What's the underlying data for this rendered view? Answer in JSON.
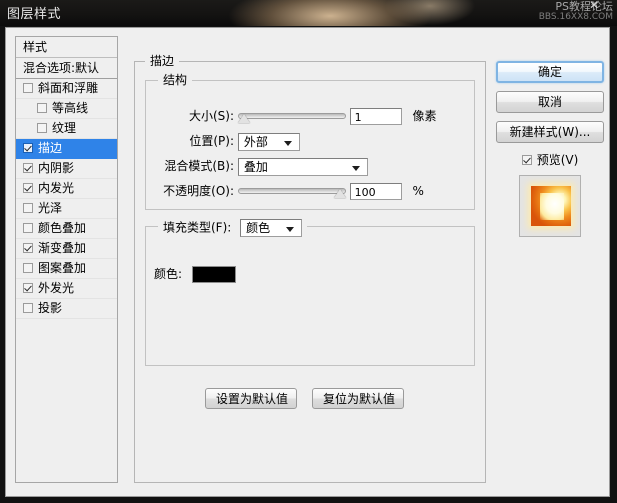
{
  "window": {
    "title": "图层样式",
    "watermark_line1": "PS教程论坛",
    "watermark_line2": "BBS.16XX8.COM",
    "close_glyph": "✕"
  },
  "styles_panel": {
    "header": "样式",
    "blending_options": "混合选项:默认",
    "effects": [
      {
        "label": "斜面和浮雕",
        "checked": false,
        "selected": false,
        "indent": false
      },
      {
        "label": "等高线",
        "checked": false,
        "selected": false,
        "indent": true
      },
      {
        "label": "纹理",
        "checked": false,
        "selected": false,
        "indent": true
      },
      {
        "label": "描边",
        "checked": true,
        "selected": true,
        "indent": false
      },
      {
        "label": "内阴影",
        "checked": true,
        "selected": false,
        "indent": false
      },
      {
        "label": "内发光",
        "checked": true,
        "selected": false,
        "indent": false
      },
      {
        "label": "光泽",
        "checked": false,
        "selected": false,
        "indent": false
      },
      {
        "label": "颜色叠加",
        "checked": false,
        "selected": false,
        "indent": false
      },
      {
        "label": "渐变叠加",
        "checked": true,
        "selected": false,
        "indent": false
      },
      {
        "label": "图案叠加",
        "checked": false,
        "selected": false,
        "indent": false
      },
      {
        "label": "外发光",
        "checked": true,
        "selected": false,
        "indent": false
      },
      {
        "label": "投影",
        "checked": false,
        "selected": false,
        "indent": false
      }
    ]
  },
  "main": {
    "group_title": "描边",
    "structure": {
      "title": "结构",
      "size_label": "大小(S):",
      "size_value": "1",
      "size_unit": "像素",
      "size_slider_percent": 0,
      "position_label": "位置(P):",
      "position_value": "外部",
      "blend_mode_label": "混合模式(B):",
      "blend_mode_value": "叠加",
      "opacity_label": "不透明度(O):",
      "opacity_value": "100",
      "opacity_unit": "%",
      "opacity_slider_percent": 100
    },
    "fill": {
      "fill_type_label": "填充类型(F):",
      "fill_type_value": "颜色",
      "color_label": "颜色:",
      "color_value": "#000000"
    },
    "set_default_label": "设置为默认值",
    "reset_default_label": "复位为默认值"
  },
  "right": {
    "ok_label": "确定",
    "cancel_label": "取消",
    "new_style_label": "新建样式(W)...",
    "preview_label": "预览(V)",
    "preview_checked": true
  }
}
